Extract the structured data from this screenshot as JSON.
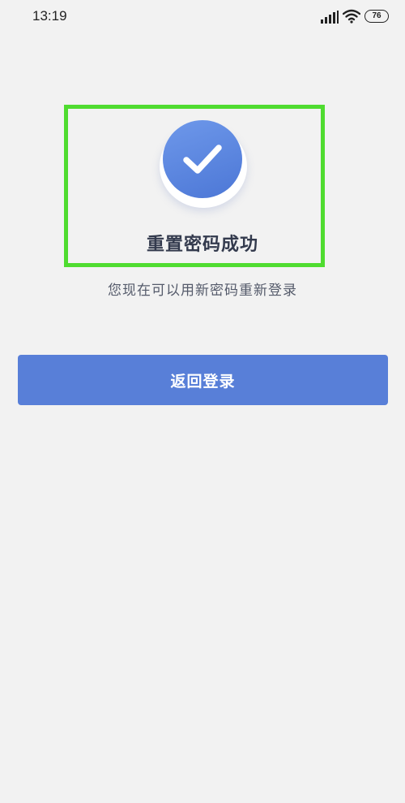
{
  "status_bar": {
    "time": "13:19",
    "battery": "76",
    "icons": [
      "signal-icon",
      "wifi-icon",
      "battery-icon"
    ]
  },
  "success": {
    "icon": "check-icon",
    "title": "重置密码成功",
    "subtitle": "您现在可以用新密码重新登录"
  },
  "actions": {
    "back_to_login": "返回登录"
  },
  "colors": {
    "background": "#f2f2f2",
    "accent": "#587fd8",
    "highlight": "#4fdc30",
    "title_text": "#333a4d",
    "subtitle_text": "#555b6b"
  }
}
